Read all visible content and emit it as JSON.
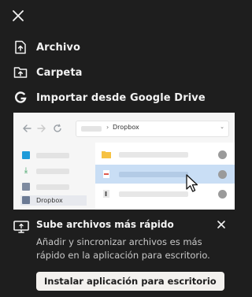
{
  "menu": {
    "items": [
      {
        "label": "Archivo",
        "icon": "file-upload-icon"
      },
      {
        "label": "Carpeta",
        "icon": "folder-upload-icon"
      },
      {
        "label": "Importar desde Google Drive",
        "icon": "google-icon"
      }
    ]
  },
  "preview": {
    "address_text": "Dropbox",
    "sidebar_selected_label": "Dropbox"
  },
  "banner": {
    "title": "Sube archivos más rápido",
    "description": "Añadir y sincronizar archivos es más rápido en la aplicación para escritorio.",
    "button_label": "Instalar aplicación para escritorio"
  },
  "colors": {
    "background": "#1e1e1e",
    "text": "#f2f2f2",
    "button_bg": "#f3f1ee",
    "selected_row": "#c9def5"
  }
}
